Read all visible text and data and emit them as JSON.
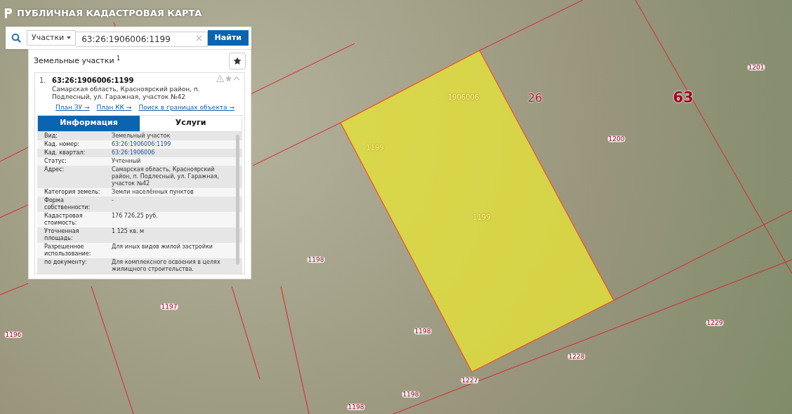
{
  "app_title": "ПУБЛИЧНАЯ КАДАСТРОВАЯ КАРТА",
  "search": {
    "category": "Участки",
    "value": "63:26:1906006:1199",
    "button": "Найти"
  },
  "results": {
    "title": "Земельные участки",
    "count": "1"
  },
  "result": {
    "index": "1.",
    "number": "63:26:1906006:1199",
    "address": "Самарская область, Красноярский район, п. Подлесный, ул. Гаражная, участок №42",
    "expanded": true,
    "links": [
      "План ЗУ →",
      "План КК →",
      "Поиск в границах объекта →"
    ]
  },
  "tabs": [
    {
      "label": "Информация",
      "selected": true
    },
    {
      "label": "Услуги",
      "selected": false
    }
  ],
  "info_rows": [
    {
      "label": "Вид:",
      "value": "Земельный участок",
      "kind": "text"
    },
    {
      "label": "Кад. номер:",
      "value": "63:26:1906006:1199",
      "kind": "link"
    },
    {
      "label": "Кад. квартал:",
      "value": "63:26:1906006",
      "kind": "link"
    },
    {
      "label": "Статус:",
      "value": "Учтенный",
      "kind": "text"
    },
    {
      "label": "Адрес:",
      "value": "Самарская область, Красноярский район, п. Подлесный, ул. Гаражная, участок №42",
      "kind": "text"
    },
    {
      "label": "Категория земель:",
      "value": "Земли населённых пунктов",
      "kind": "text"
    },
    {
      "label": "Форма собственности:",
      "value": "-",
      "kind": "text"
    },
    {
      "label": "Кадастровая стоимость:",
      "value": "176 726,25 руб.",
      "kind": "text"
    },
    {
      "label": "Уточненная площадь:",
      "value": "1 125 кв. м",
      "kind": "text"
    },
    {
      "label": "Разрешенное использование:",
      "value": "Для иных видов жилой застройки",
      "kind": "text"
    },
    {
      "label": "по документу:",
      "value": "Для комплексного освоения в целях жилищного строительства.",
      "kind": "text"
    }
  ],
  "map_labels": [
    {
      "text": "1201",
      "kind": "parcel"
    },
    {
      "text": "1906006",
      "kind": "selected"
    },
    {
      "text": "26",
      "kind": "district"
    },
    {
      "text": "63",
      "kind": "region"
    },
    {
      "text": "1199",
      "kind": "selected"
    },
    {
      "text": "1200",
      "kind": "parcel"
    },
    {
      "text": "1199",
      "kind": "selected"
    },
    {
      "text": "1198",
      "kind": "parcel"
    },
    {
      "text": "1197",
      "kind": "parcel"
    },
    {
      "text": "1196",
      "kind": "parcel"
    },
    {
      "text": "1198",
      "kind": "parcel"
    },
    {
      "text": "1229",
      "kind": "parcel"
    },
    {
      "text": "1228",
      "kind": "parcel"
    },
    {
      "text": "1227",
      "kind": "parcel"
    },
    {
      "text": "1198",
      "kind": "parcel"
    },
    {
      "text": "1198",
      "kind": "parcel"
    }
  ]
}
